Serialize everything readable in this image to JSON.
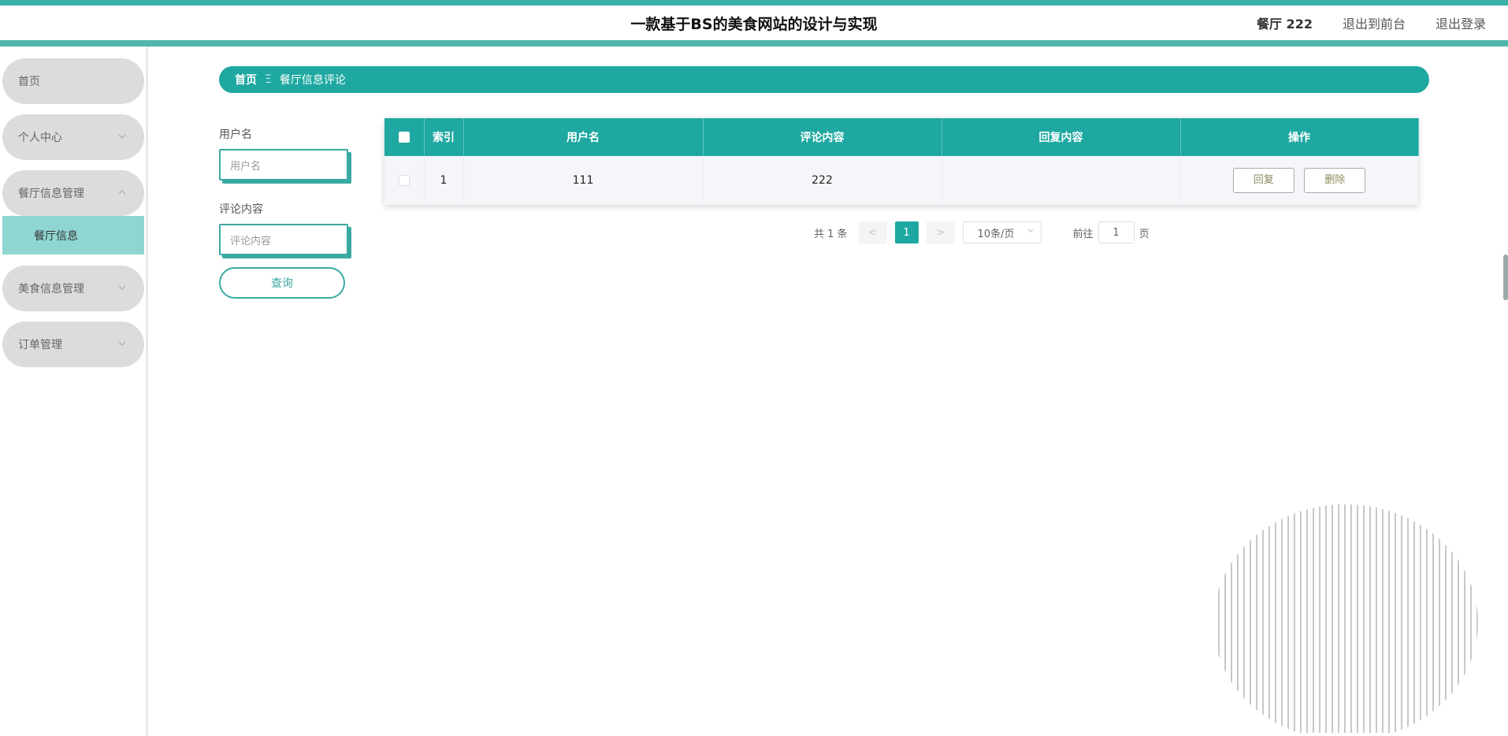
{
  "header": {
    "title": "一款基于BS的美食网站的设计与实现",
    "user": "餐厅 222",
    "front_link": "退出到前台",
    "logout_link": "退出登录"
  },
  "sidebar": {
    "items": [
      {
        "label": "首页"
      },
      {
        "label": "个人中心"
      },
      {
        "label": "餐厅信息管理"
      },
      {
        "label": "美食信息管理"
      },
      {
        "label": "订单管理"
      }
    ],
    "sub_item": "餐厅信息"
  },
  "breadcrumb": {
    "home": "首页",
    "separator": "Ξ",
    "current": "餐厅信息评论"
  },
  "filters": {
    "username_label": "用户名",
    "username_placeholder": "用户名",
    "comment_label": "评论内容",
    "comment_placeholder": "评论内容",
    "query_button": "查询"
  },
  "table": {
    "headers": [
      "索引",
      "用户名",
      "评论内容",
      "回复内容",
      "操作"
    ],
    "rows": [
      {
        "index": "1",
        "username": "111",
        "comment": "222",
        "reply": ""
      }
    ],
    "reply_button": "回复",
    "delete_button": "删除"
  },
  "pagination": {
    "total": "共 1 条",
    "prev": "<",
    "current_page": "1",
    "next": ">",
    "page_size": "10条/页",
    "goto_label": "前往",
    "goto_value": "1",
    "page_suffix": "页"
  }
}
